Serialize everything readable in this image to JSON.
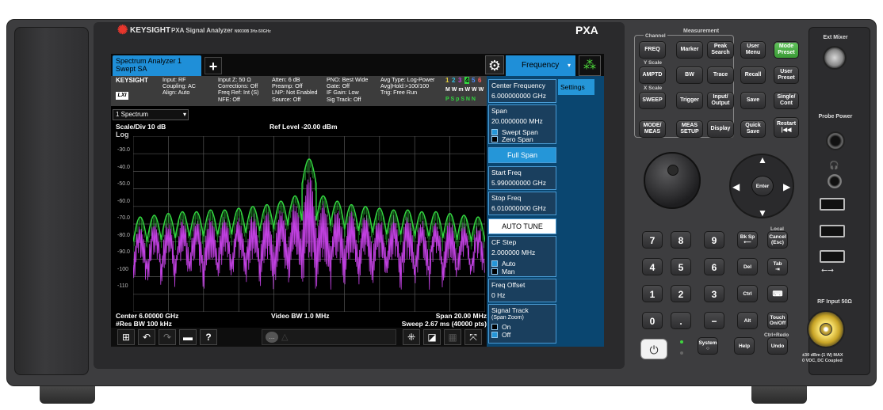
{
  "instrument": {
    "brand": "KEYSIGHT",
    "model": "PXA Signal Analyzer",
    "model_small": "N9030B  3Hz-50GHz",
    "series": "PXA"
  },
  "screen": {
    "mode_tab": {
      "line1": "Spectrum Analyzer 1",
      "line2": "Swept SA"
    },
    "add_label": "+",
    "freq_tab_label": "Frequency",
    "info": {
      "brand": "KEYSIGHT",
      "lxi": "LXI",
      "col1": "Input: RF\nCoupling: AC\nAlign: Auto",
      "col2": "Input Z: 50 Ω\nCorrections: Off\nFreq Ref: Int (S)\nNFE: Off",
      "col3": "Atten: 6 dB\nPreamp: Off\nLNP: Not Enabled\nSource: Off",
      "col4": "PNO: Best Wide\nGate: Off\nIF Gain: Low\nSig Track: Off",
      "col5": "Avg Type: Log-Power\nAvg|Hold:>100/100\nTrig: Free Run",
      "trace_numbers": [
        "1",
        "2",
        "3",
        "4",
        "5",
        "6"
      ],
      "trace_types": "M W m W W W",
      "trace_dets": "P S p S N N"
    },
    "trace_select": "1 Spectrum",
    "scale": "Scale/Div 10 dB",
    "log": "Log",
    "ref_level": "Ref Level -20.00 dBm",
    "y_ticks": [
      "-30.0",
      "-40.0",
      "-50.0",
      "-60.0",
      "-70.0",
      "-80.0",
      "-90.0",
      "-100",
      "-110"
    ],
    "center": "Center 6.00000 GHz",
    "res_bw": "#Res BW 100 kHz",
    "video_bw": "Video BW 1.0 MHz",
    "span": "Span 20.00 MHz",
    "sweep": "Sweep 2.67 ms (40000 pts)",
    "toolbar_icons": [
      "windows-icon",
      "undo-icon",
      "redo-icon",
      "folder-icon",
      "help-icon"
    ],
    "settings_tab": "Settings",
    "softkeys": {
      "center_freq": {
        "label": "Center Frequency",
        "value": "6.000000000 GHz"
      },
      "span": {
        "label": "Span",
        "value": "20.0000000 MHz"
      },
      "swept_span": "Swept Span",
      "zero_span": "Zero Span",
      "full_span": "Full Span",
      "start_freq": {
        "label": "Start Freq",
        "value": "5.990000000 GHz"
      },
      "stop_freq": {
        "label": "Stop Freq",
        "value": "6.010000000 GHz"
      },
      "auto_tune": "AUTO TUNE",
      "cf_step": {
        "label": "CF Step",
        "value": "2.000000 MHz"
      },
      "auto": "Auto",
      "man": "Man",
      "freq_offset": {
        "label": "Freq Offset",
        "value": "0 Hz"
      },
      "signal_track": {
        "label": "Signal Track",
        "sub": "(Span Zoom)"
      },
      "on": "On",
      "off": "Off"
    }
  },
  "chart_data": {
    "type": "line",
    "title": "",
    "xlabel": "",
    "ylabel": "",
    "x_range_ghz": [
      5.99,
      6.01
    ],
    "ylim": [
      -120,
      -20
    ],
    "grid": true,
    "series": [
      {
        "color": "#33d640",
        "peak_dbm": -33,
        "sidelobe_peaks_dbm": [
          -66,
          -65,
          -64,
          -63,
          -63,
          -62,
          -62,
          -61,
          -60,
          -59,
          -57,
          -54,
          -46,
          -54,
          -57,
          -59,
          -60,
          -61,
          -62,
          -62,
          -63,
          -63,
          -64,
          -65,
          -66
        ]
      },
      {
        "color": "#c040e0",
        "peak_dbm": -38,
        "floor_dbm": -110
      }
    ]
  },
  "panel": {
    "channel": "Channel",
    "measurement": "Measurement",
    "y_scale": "Y Scale",
    "x_scale": "X Scale",
    "keys": {
      "freq": "FREQ",
      "marker": "Marker",
      "peak_search": "Peak Search",
      "user_menu": "User Menu",
      "mode_preset": "Mode Preset",
      "amptd": "AMPTD",
      "bw": "BW",
      "trace": "Trace",
      "recall": "Recall",
      "user_preset": "User Preset",
      "sweep": "SWEEP",
      "trigger": "Trigger",
      "input_output": "Input/ Output",
      "save": "Save",
      "single_cont": "Single/ Cont",
      "mode_meas": "MODE/ MEAS",
      "meas_setup": "MEAS SETUP",
      "display": "Display",
      "quick_save": "Quick Save",
      "restart": "Restart",
      "enter": "Enter",
      "local": "Local",
      "bk_sp": "Bk Sp",
      "cancel_esc": "Cancel (Esc)",
      "del": "Del",
      "tab": "Tab",
      "ctrl": "Ctrl",
      "alt": "Alt",
      "touch_onoff": "Touch On/Off",
      "system": "System",
      "help": "Help",
      "undo": "Undo",
      "ctrl_redo": "Ctrl+Redo"
    },
    "numpad": [
      "7",
      "8",
      "9",
      "4",
      "5",
      "6",
      "1",
      "2",
      "3",
      "0",
      ".",
      "−"
    ]
  },
  "ports": {
    "ext_mixer": "Ext Mixer",
    "probe_power": "Probe Power",
    "rf_input": "RF Input 50Ω",
    "rf_warning": "±30 dBm (1 W) MAX\n0 VDC, DC Coupled"
  }
}
